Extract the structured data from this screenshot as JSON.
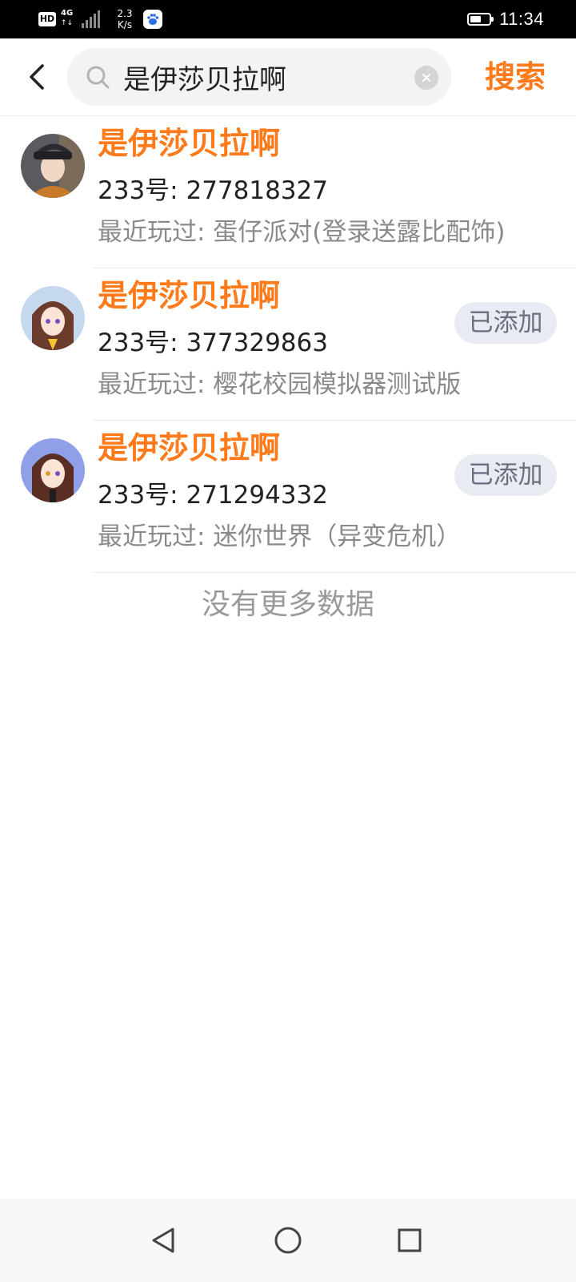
{
  "status_bar": {
    "hd": "HD",
    "network": "4G",
    "network_arrows": "↑↓",
    "speed_value": "2.3",
    "speed_unit": "K/s",
    "battery_level": 0.6,
    "time": "11:34"
  },
  "search": {
    "query": "是伊莎贝拉啊",
    "button_label": "搜索",
    "icons": {
      "back": "chevron-left-icon",
      "search": "search-icon",
      "clear": "clear-icon"
    }
  },
  "results": [
    {
      "name": "是伊莎贝拉啊",
      "id_line": "233号: 277818327",
      "recent_line": "最近玩过: 蛋仔派对(登录送露比配饰)",
      "added": false,
      "added_label": ""
    },
    {
      "name": "是伊莎贝拉啊",
      "id_line": "233号: 377329863",
      "recent_line": "最近玩过: 樱花校园模拟器测试版",
      "added": true,
      "added_label": "已添加"
    },
    {
      "name": "是伊莎贝拉啊",
      "id_line": "233号: 271294332",
      "recent_line": "最近玩过: 迷你世界（异变危机）",
      "added": true,
      "added_label": "已添加"
    }
  ],
  "no_more_text": "没有更多数据",
  "nav_bar": {
    "icons": [
      "back-triangle-icon",
      "home-circle-icon",
      "recents-square-icon"
    ]
  },
  "colors": {
    "accent": "#ff7a1a",
    "badge_bg": "#e9ebf2",
    "badge_text": "#6a6f80",
    "secondary_text": "#8a8a8a"
  }
}
